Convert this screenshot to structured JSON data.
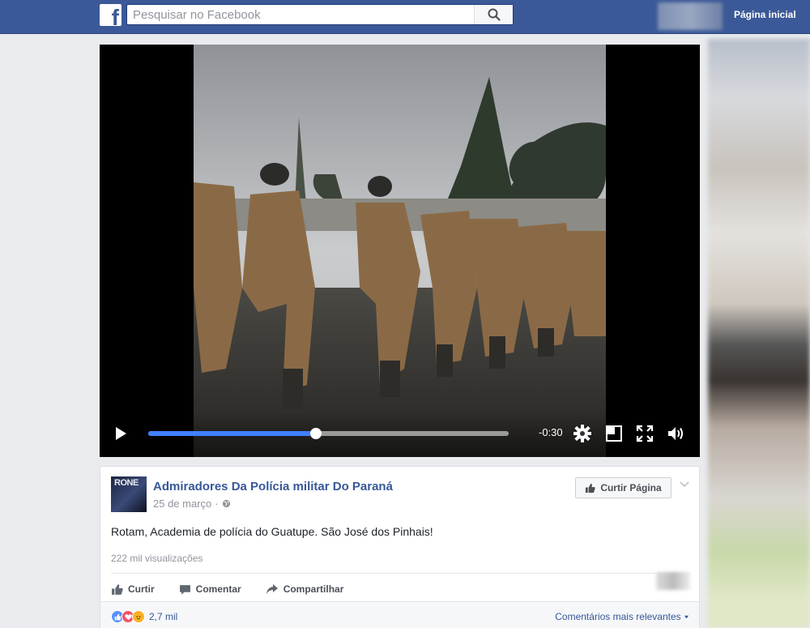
{
  "topbar": {
    "logo_letter": "f",
    "search_placeholder": "Pesquisar no Facebook",
    "home_label": "Página inicial"
  },
  "video": {
    "time_remaining": "-0:30",
    "progress": 0.465,
    "icons": [
      "play-icon",
      "settings-icon",
      "picture-in-picture-icon",
      "fullscreen-icon",
      "volume-icon"
    ]
  },
  "post": {
    "avatar_text": "RONE",
    "page_name": "Admiradores Da Polícia militar Do Paraná",
    "date": "25 de março",
    "like_page_label": "Curtir Página",
    "text": "Rotam, Academia de polícia do Guatupe. São José dos Pinhais!",
    "views": "222 mil visualizações",
    "actions": {
      "like": "Curtir",
      "comment": "Comentar",
      "share": "Compartilhar"
    },
    "reaction_count": "2,7 mil",
    "sort_label": "Comentários mais relevantes"
  },
  "colors": {
    "brand_blue": "#3b5998",
    "link_blue": "#365899",
    "progress_blue": "#4080ff"
  }
}
